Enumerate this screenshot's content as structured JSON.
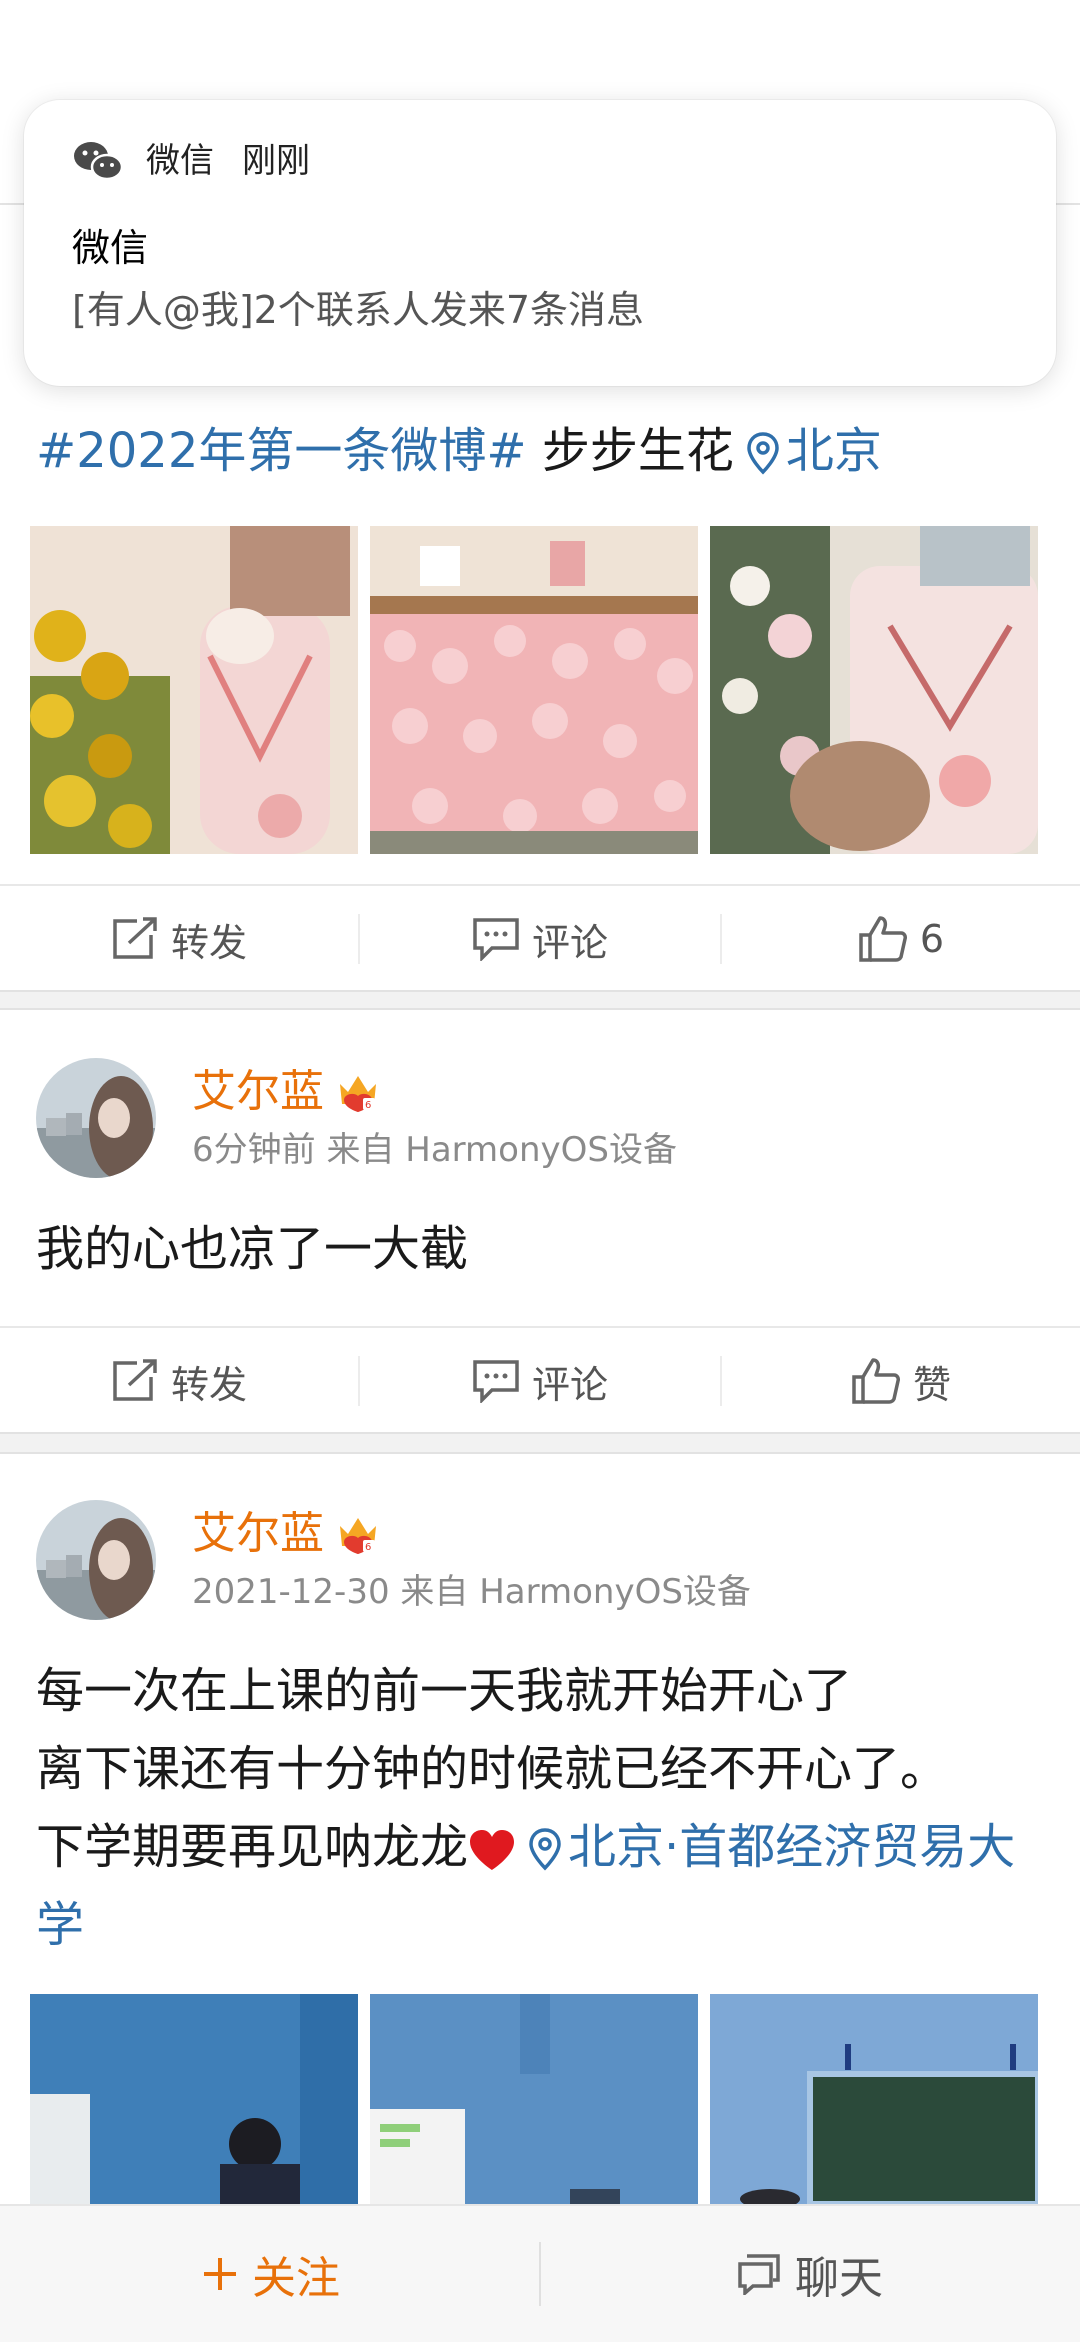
{
  "notification": {
    "app_name": "微信",
    "time": "刚刚",
    "title": "微信",
    "body": "[有人@我]2个联系人发来7条消息"
  },
  "post1": {
    "hashtag": "#2022年第一条微博#",
    "text": " 步步生花",
    "location": "北京",
    "actions": {
      "repost": "转发",
      "comment": "评论",
      "like": "6"
    }
  },
  "post2": {
    "username": "艾尔蓝",
    "meta": "6分钟前  来自 HarmonyOS设备",
    "text": "我的心也凉了一大截",
    "actions": {
      "repost": "转发",
      "comment": "评论",
      "like": "赞"
    }
  },
  "post3": {
    "username": "艾尔蓝",
    "meta": "2021-12-30  来自 HarmonyOS设备",
    "line1": "每一次在上课的前一天我就开始开心了",
    "line2": "离下课还有十分钟的时候就已经不开心了。",
    "line3": "下学期要再见呐龙龙",
    "location": "北京·首都经济贸易大学"
  },
  "bottom_bar": {
    "follow": "关注",
    "chat": "聊天"
  },
  "colors": {
    "accent": "#e8710a",
    "link": "#2f6fab"
  },
  "icons": [
    "wechat-icon",
    "location-pin-icon",
    "repost-icon",
    "comment-icon",
    "like-icon",
    "crown-icon",
    "plus-icon",
    "chat-icon",
    "heart-emoji"
  ]
}
